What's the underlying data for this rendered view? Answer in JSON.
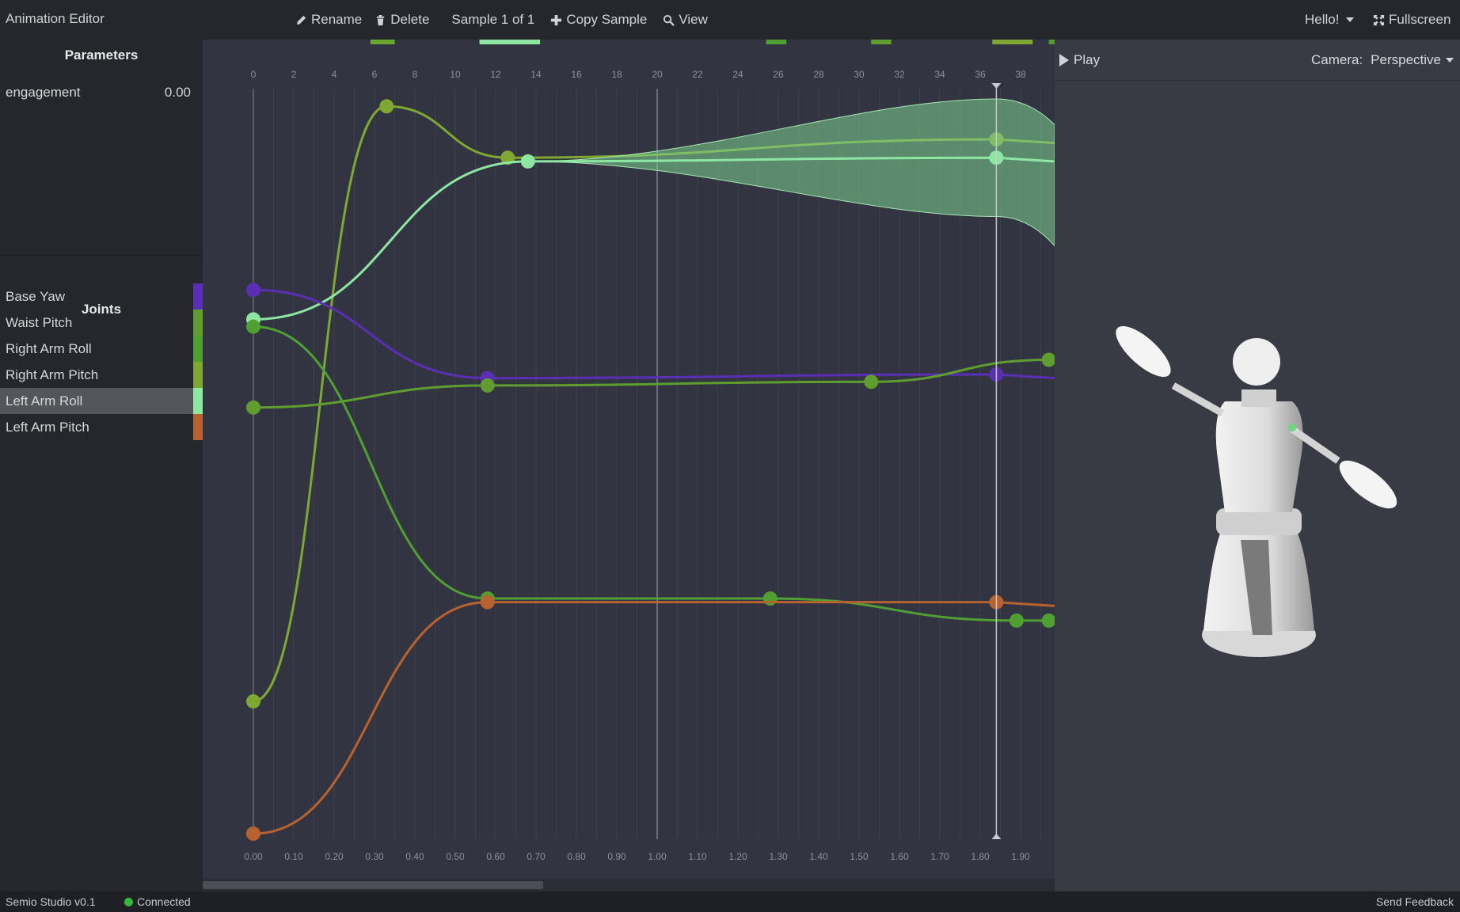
{
  "topbar": {
    "app_title": "Animation Editor",
    "rename": "Rename",
    "delete": "Delete",
    "sample": "Sample 1 of 1",
    "copy_sample": "Copy Sample",
    "view": "View",
    "user_menu": "Hello!",
    "fullscreen": "Fullscreen"
  },
  "parameters": {
    "title": "Parameters",
    "items": [
      {
        "name": "engagement",
        "value": "0.00"
      }
    ]
  },
  "joints": {
    "title": "Joints",
    "items": [
      {
        "label": "Base Yaw",
        "color": "#5b2fb5",
        "selected": false
      },
      {
        "label": "Waist Pitch",
        "color": "#5f9e2e",
        "selected": false
      },
      {
        "label": "Right Arm Roll",
        "color": "#4f9f33",
        "selected": false
      },
      {
        "label": "Right Arm Pitch",
        "color": "#7ea832",
        "selected": false
      },
      {
        "label": "Left Arm Roll",
        "color": "#8ee6a3",
        "selected": true
      },
      {
        "label": "Left Arm Pitch",
        "color": "#b7622f",
        "selected": false
      }
    ]
  },
  "timeline": {
    "frame_ticks": [
      "0",
      "2",
      "4",
      "6",
      "8",
      "10",
      "12",
      "14",
      "16",
      "18",
      "20",
      "22",
      "24",
      "26",
      "28",
      "30",
      "32",
      "34",
      "36",
      "38"
    ],
    "time_ticks": [
      "0.00",
      "0.10",
      "0.20",
      "0.30",
      "0.40",
      "0.50",
      "0.60",
      "0.70",
      "0.80",
      "0.90",
      "1.00",
      "1.10",
      "1.20",
      "1.30",
      "1.40",
      "1.50",
      "1.60",
      "1.70",
      "1.80",
      "1.90"
    ],
    "playhead_time": 1.84,
    "curves": [
      {
        "joint": "Right Arm Pitch",
        "color": "#7ea832",
        "keyframes": [
          [
            0.0,
            0.18
          ],
          [
            0.33,
            0.99
          ],
          [
            0.63,
            0.92
          ],
          [
            1.84,
            0.945
          ]
        ]
      },
      {
        "joint": "Left Arm Roll",
        "color": "#8ee6a3",
        "keyframes": [
          [
            0.0,
            0.7
          ],
          [
            0.68,
            0.915
          ],
          [
            1.84,
            0.92
          ]
        ],
        "band": true
      },
      {
        "joint": "Base Yaw",
        "color": "#5b2fb5",
        "keyframes": [
          [
            0.0,
            0.74
          ],
          [
            0.58,
            0.62
          ],
          [
            1.84,
            0.625
          ]
        ]
      },
      {
        "joint": "Waist Pitch",
        "color": "#5f9e2e",
        "keyframes": [
          [
            0.0,
            0.58
          ],
          [
            0.58,
            0.61
          ],
          [
            1.53,
            0.615
          ],
          [
            1.97,
            0.645
          ]
        ]
      },
      {
        "joint": "Right Arm Roll",
        "color": "#4f9f33",
        "keyframes": [
          [
            0.0,
            0.69
          ],
          [
            0.58,
            0.32
          ],
          [
            1.28,
            0.32
          ],
          [
            1.89,
            0.29
          ],
          [
            1.97,
            0.29
          ]
        ]
      },
      {
        "joint": "Left Arm Pitch",
        "color": "#b7622f",
        "keyframes": [
          [
            0.0,
            0.0
          ],
          [
            0.58,
            0.315
          ],
          [
            1.84,
            0.315
          ]
        ]
      }
    ]
  },
  "viewport": {
    "play": "Play",
    "camera_label": "Camera:",
    "camera_value": "Perspective"
  },
  "status": {
    "version": "Semio Studio v0.1",
    "connection": "Connected",
    "feedback": "Send Feedback"
  }
}
